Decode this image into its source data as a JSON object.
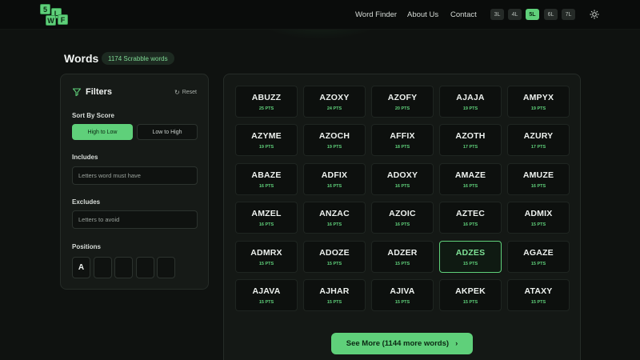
{
  "logo": {
    "tiles": [
      "5",
      "L",
      "W",
      "F"
    ],
    "color": "#5fd07a"
  },
  "nav": {
    "links": [
      "Word Finder",
      "About Us",
      "Contact"
    ],
    "lengths": [
      "3L",
      "4L",
      "5L",
      "6L",
      "7L"
    ],
    "active_length": "5L",
    "theme_icon": "sun-icon"
  },
  "page": {
    "title": "Words",
    "count_badge": "1174 Scrabble words"
  },
  "filters": {
    "title": "Filters",
    "reset_label": "Reset",
    "sort_label": "Sort By Score",
    "sort_options": [
      "High to Low",
      "Low to High"
    ],
    "sort_selected": "High to Low",
    "includes_label": "Includes",
    "includes_placeholder": "Letters word must have",
    "excludes_label": "Excludes",
    "excludes_placeholder": "Letters to avoid",
    "positions_label": "Positions",
    "positions": [
      "A",
      "",
      "",
      "",
      ""
    ]
  },
  "words": [
    {
      "word": "ABUZZ",
      "pts": "25 PTS"
    },
    {
      "word": "AZOXY",
      "pts": "24 PTS"
    },
    {
      "word": "AZOFY",
      "pts": "20 PTS"
    },
    {
      "word": "AJAJA",
      "pts": "19 PTS"
    },
    {
      "word": "AMPYX",
      "pts": "19 PTS"
    },
    {
      "word": "AZYME",
      "pts": "19 PTS"
    },
    {
      "word": "AZOCH",
      "pts": "19 PTS"
    },
    {
      "word": "AFFIX",
      "pts": "18 PTS"
    },
    {
      "word": "AZOTH",
      "pts": "17 PTS"
    },
    {
      "word": "AZURY",
      "pts": "17 PTS"
    },
    {
      "word": "ABAZE",
      "pts": "16 PTS"
    },
    {
      "word": "ADFIX",
      "pts": "16 PTS"
    },
    {
      "word": "ADOXY",
      "pts": "16 PTS"
    },
    {
      "word": "AMAZE",
      "pts": "16 PTS"
    },
    {
      "word": "AMUZE",
      "pts": "16 PTS"
    },
    {
      "word": "AMZEL",
      "pts": "16 PTS"
    },
    {
      "word": "ANZAC",
      "pts": "16 PTS"
    },
    {
      "word": "AZOIC",
      "pts": "16 PTS"
    },
    {
      "word": "AZTEC",
      "pts": "16 PTS"
    },
    {
      "word": "ADMIX",
      "pts": "15 PTS"
    },
    {
      "word": "ADMRX",
      "pts": "15 PTS"
    },
    {
      "word": "ADOZE",
      "pts": "15 PTS"
    },
    {
      "word": "ADZER",
      "pts": "15 PTS"
    },
    {
      "word": "ADZES",
      "pts": "15 PTS",
      "selected": true
    },
    {
      "word": "AGAZE",
      "pts": "15 PTS"
    },
    {
      "word": "AJAVA",
      "pts": "15 PTS"
    },
    {
      "word": "AJHAR",
      "pts": "15 PTS"
    },
    {
      "word": "AJIVA",
      "pts": "15 PTS"
    },
    {
      "word": "AKPEK",
      "pts": "15 PTS"
    },
    {
      "word": "ATAXY",
      "pts": "15 PTS"
    }
  ],
  "see_more_label": "See More (1144 more words)",
  "colors": {
    "accent": "#5fd07a",
    "background": "#0f1210",
    "panel": "#161a17"
  }
}
